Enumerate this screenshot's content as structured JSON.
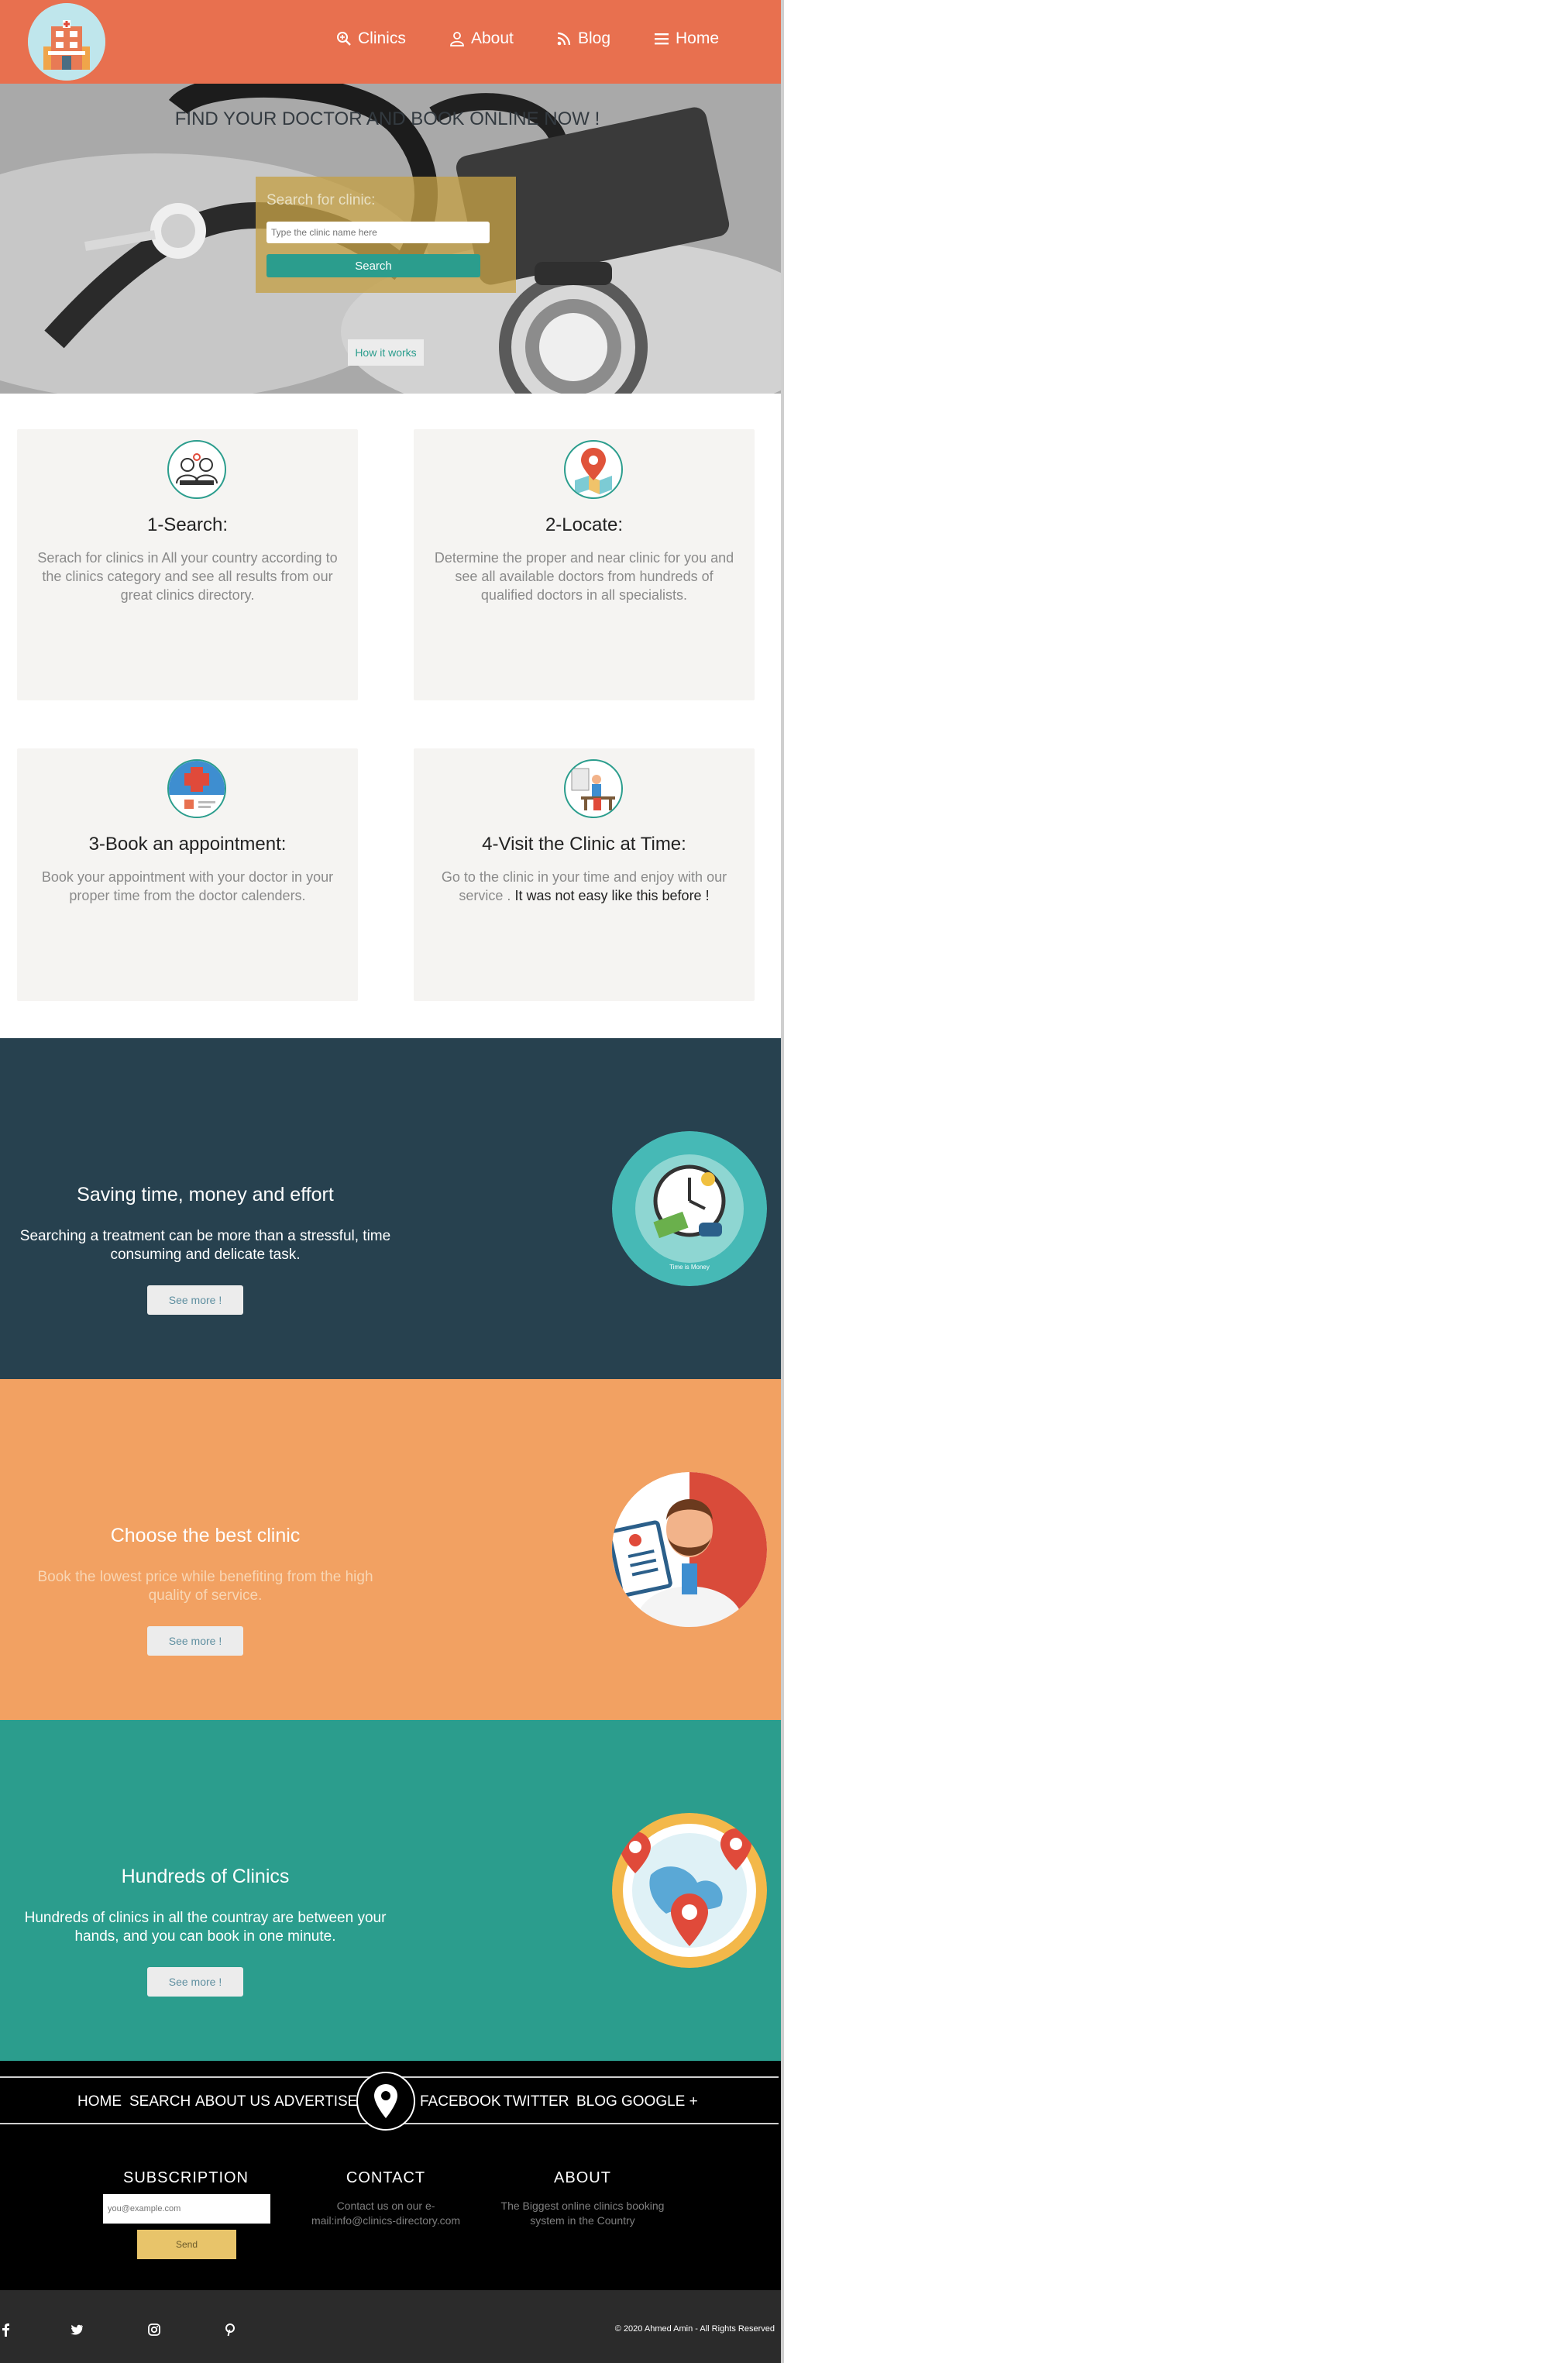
{
  "nav": {
    "clinics": "Clinics",
    "about": "About",
    "blog": "Blog",
    "home": "Home"
  },
  "hero": {
    "title": "FIND YOUR DOCTOR AND BOOK ONLINE NOW !",
    "search_label": "Search for clinic:",
    "search_placeholder": "Type the clinic name here",
    "search_button": "Search",
    "how_button": "How it works"
  },
  "steps": [
    {
      "title": "1-Search:",
      "desc": "Serach for clinics in All your country according to the clinics category and see all results from our great clinics directory.",
      "icon": "doctors-icon"
    },
    {
      "title": "2-Locate:",
      "desc": "Determine the proper and near clinic for you and see all available doctors from hundreds of qualified doctors in all specialists.",
      "icon": "map-pin-icon"
    },
    {
      "title": "3-Book an appointment:",
      "desc": "Book your appointment with your doctor in your proper time from the doctor calenders.",
      "icon": "calendar-icon"
    },
    {
      "title": "4-Visit the Clinic at Time:",
      "desc": "Go to the clinic in your time and enjoy with our service .",
      "emph": "It was not easy like this before !",
      "icon": "clinic-visit-icon"
    }
  ],
  "features": [
    {
      "title": "Saving time, money and effort",
      "desc": "Searching a treatment can be more than a stressful, time consuming and delicate task.",
      "button": "See more !",
      "art_caption": "Time is Money",
      "bg": "#27414f",
      "desc_color": "#ffffff"
    },
    {
      "title": "Choose the best clinic",
      "desc": "Book the lowest price while benefiting from the high quality of service.",
      "button": "See more !",
      "bg": "#f2a162",
      "desc_color": "#f8d6b4"
    },
    {
      "title": "Hundreds of Clinics",
      "desc": "Hundreds of clinics in all the countray are between your hands, and you can book in one minute.",
      "button": "See more !",
      "bg": "#2b9d8d",
      "desc_color": "#ffffff"
    }
  ],
  "footer": {
    "links_left": [
      "HOME",
      "SEARCH",
      "ABOUT US",
      "ADVERTISE"
    ],
    "links_right": [
      "FACEBOOK",
      "TWITTER",
      "BLOG",
      "GOOGLE +"
    ],
    "subscription_title": "SUBSCRIPTION",
    "subscription_placeholder": "you@example.com",
    "send_button": "Send",
    "contact_title": "CONTACT",
    "contact_text": "Contact us on our e-mail:info@clinics-directory.com",
    "about_title": "ABOUT",
    "about_text": "The Biggest online clinics booking system in the Country",
    "copyright": "© 2020 Ahmed Amin - All Rights Reserved"
  },
  "colors": {
    "header": "#e8704f",
    "teal": "#2b9d8d",
    "dark_band": "#27414f",
    "orange_band": "#f2a162",
    "footer": "#000000",
    "bottom_bar": "#2b2b2b"
  }
}
